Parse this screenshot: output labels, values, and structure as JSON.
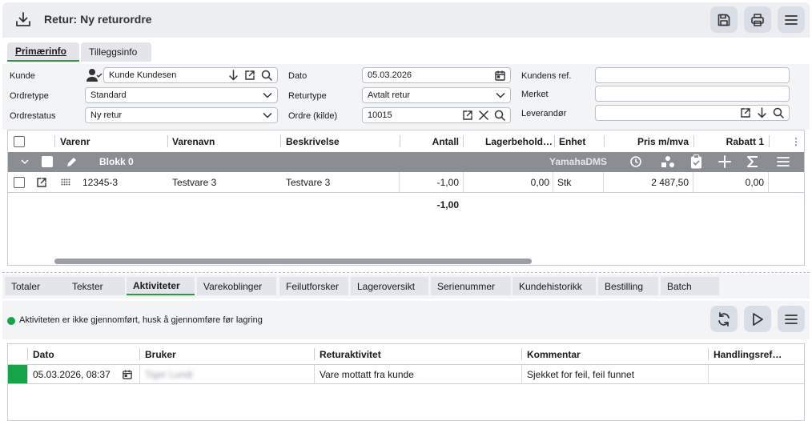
{
  "header": {
    "title": "Retur: Ny returordre"
  },
  "tabs_top": [
    {
      "label": "Primærinfo",
      "active": true
    },
    {
      "label": "Tilleggsinfo",
      "active": false
    }
  ],
  "form": {
    "kunde_label": "Kunde",
    "kunde_value": "Kunde Kundesen",
    "ordretype_label": "Ordretype",
    "ordretype_value": "Standard",
    "ordrestatus_label": "Ordrestatus",
    "ordrestatus_value": "Ny retur",
    "dato_label": "Dato",
    "dato_value": "05.03.2026",
    "returtype_label": "Returtype",
    "returtype_value": "Avtalt retur",
    "ordre_label": "Ordre (kilde)",
    "ordre_value": "10015",
    "kundensref_label": "Kundens ref.",
    "kundensref_value": "",
    "merket_label": "Merket",
    "merket_value": "",
    "leverandor_label": "Leverandør",
    "leverandor_value": ""
  },
  "grid": {
    "headers": [
      "Varenr",
      "Varenavn",
      "Beskrivelse",
      "Antall",
      "Lagerbehold…",
      "Enhet",
      "Pris m/mva",
      "Rabatt 1"
    ],
    "group": {
      "label": "Blokk 0",
      "source": "YamahaDMS"
    },
    "rows": [
      {
        "varenr": "12345-3",
        "varenavn": "Testvare 3",
        "beskrivelse": "Testvare 3",
        "antall": "-1,00",
        "lagerbeholdning": "0,00",
        "enhet": "Stk",
        "pris": "2 487,50",
        "rabatt": "0,00"
      }
    ],
    "sum_antall": "-1,00"
  },
  "tabs_bottom": [
    {
      "label": "Totaler",
      "active": false
    },
    {
      "label": "Tekster",
      "active": false
    },
    {
      "label": "Aktiviteter",
      "active": true
    },
    {
      "label": "Varekoblinger",
      "active": false
    },
    {
      "label": "Feilutforsker",
      "active": false
    },
    {
      "label": "Lageroversikt",
      "active": false
    },
    {
      "label": "Serienummer",
      "active": false
    },
    {
      "label": "Kundehistorikk",
      "active": false
    },
    {
      "label": "Bestilling",
      "active": false
    },
    {
      "label": "Batch",
      "active": false
    }
  ],
  "activity": {
    "notice": "Aktiviteten er ikke gjennomført, husk å gjennomføre før lagring",
    "headers": [
      "Dato",
      "Bruker",
      "Returaktivitet",
      "Kommentar",
      "Handlingsref…"
    ],
    "rows": [
      {
        "dato": "05.03.2026, 08:37",
        "bruker": "Tiger Lundi",
        "returaktivitet": "Vare mottatt fra kunde",
        "kommentar": "Sjekket for feil, feil funnet",
        "handlingsref": ""
      }
    ]
  },
  "colors": {
    "accent_green": "#2e9b3a",
    "status_green": "#16a34a",
    "group_row": "#8a8d92"
  }
}
